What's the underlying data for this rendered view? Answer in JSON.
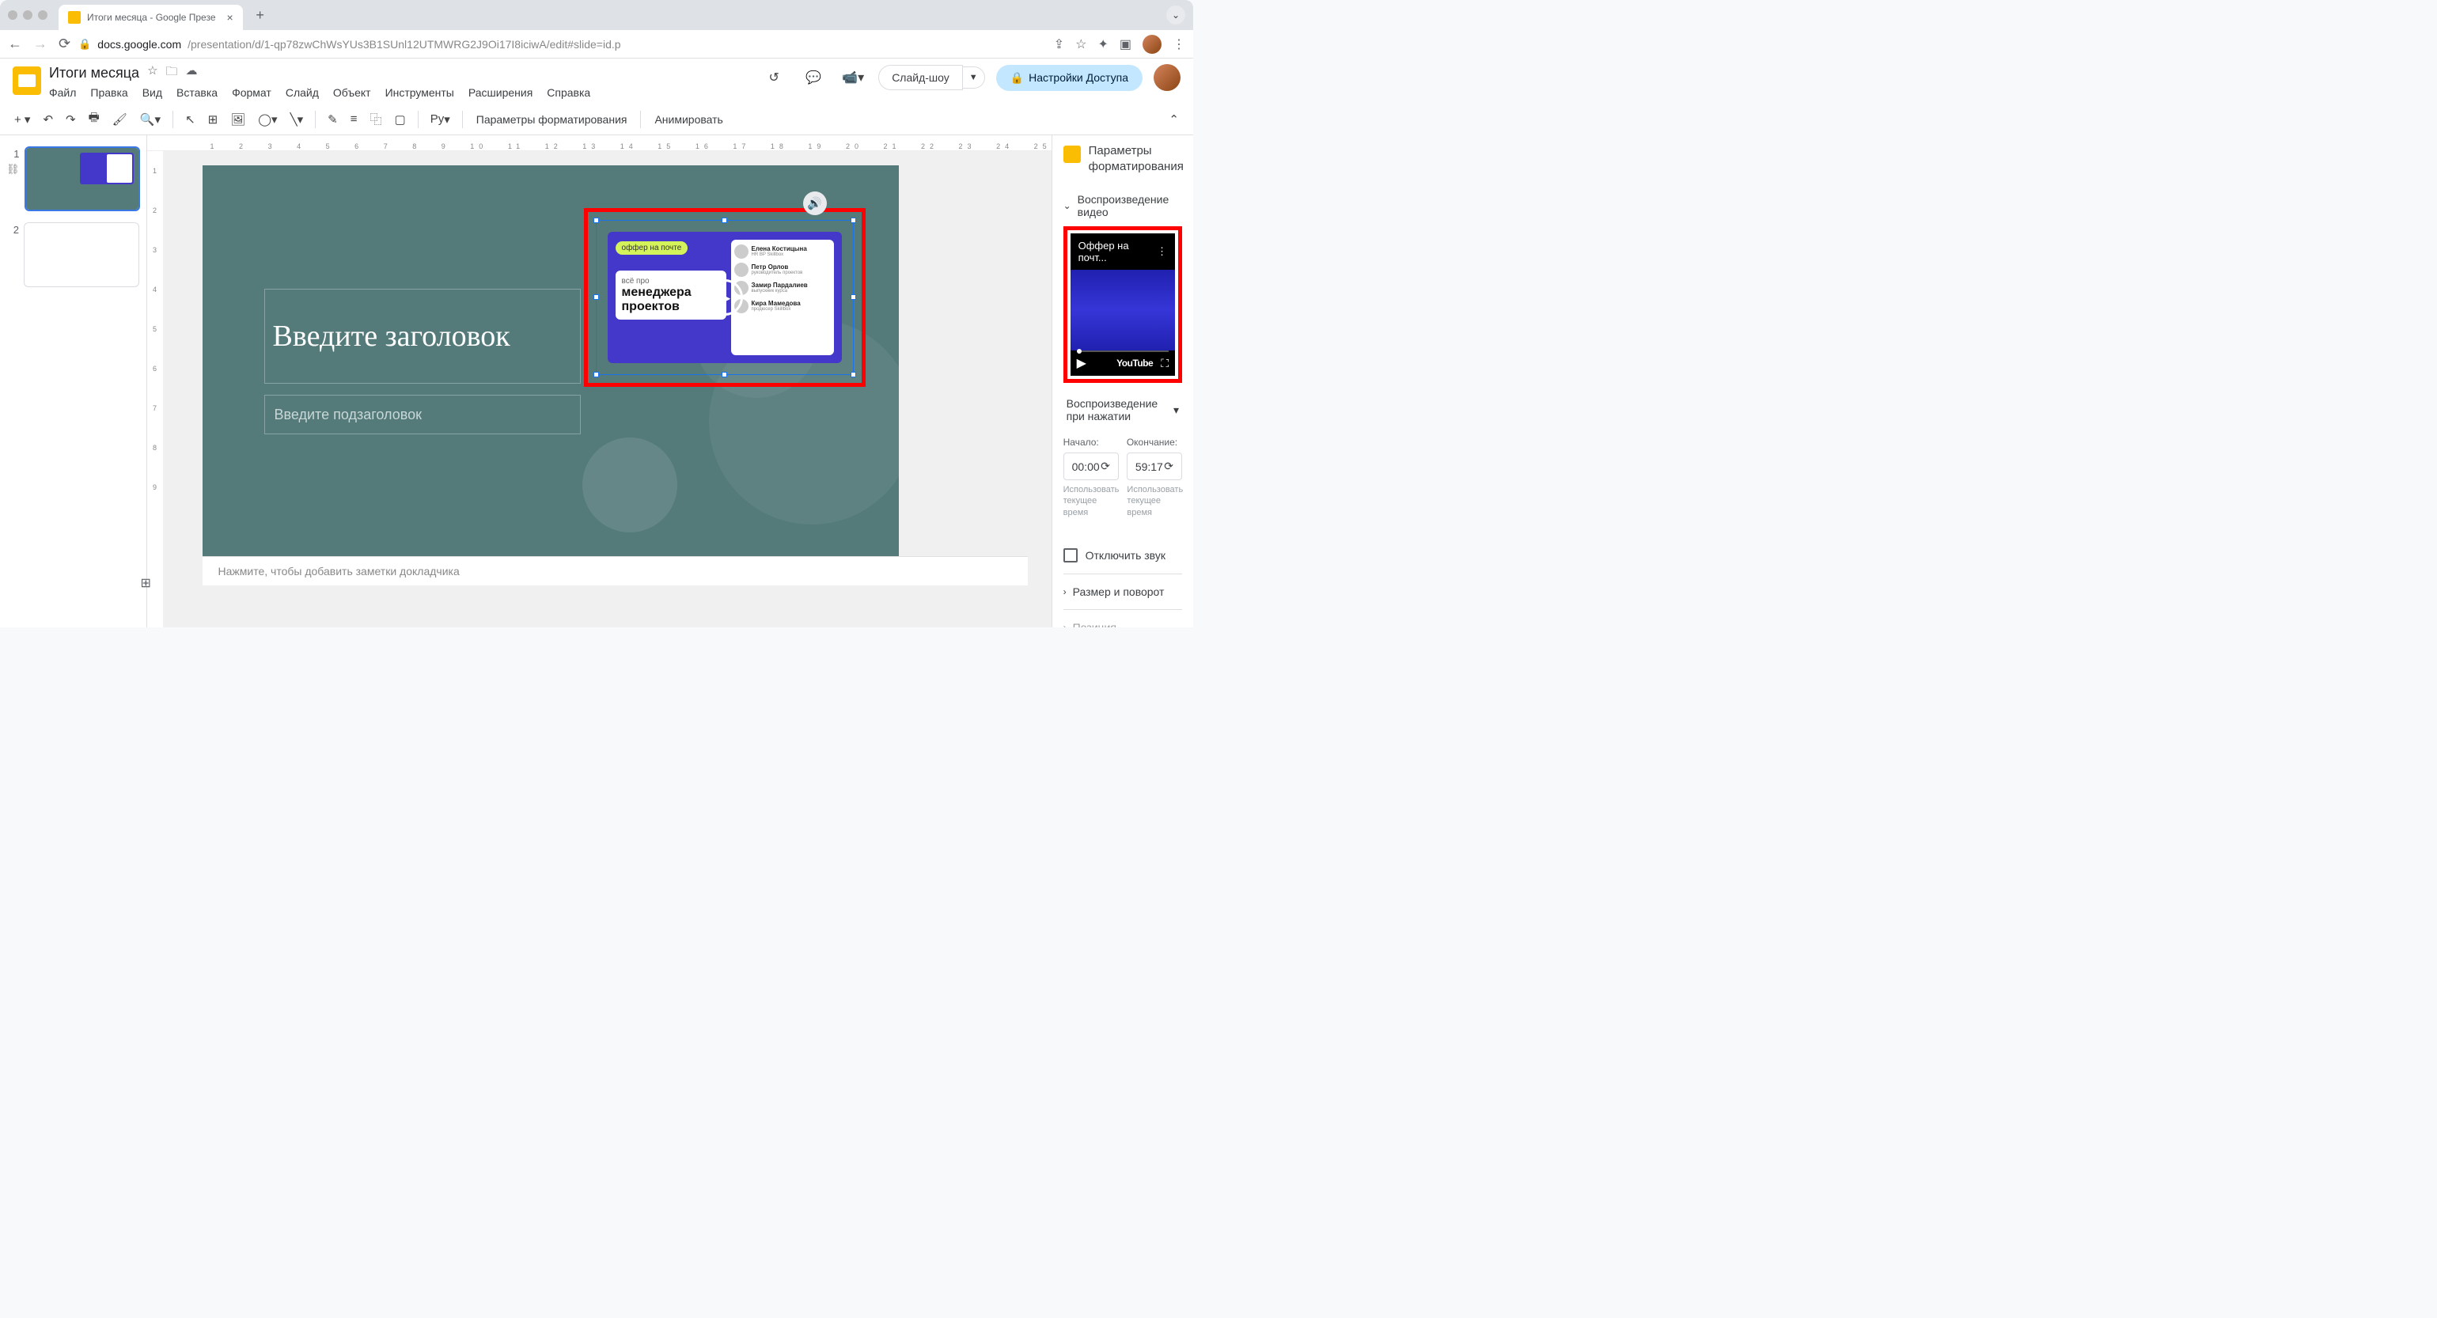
{
  "browser": {
    "tab_title": "Итоги месяца - Google Презе",
    "url_host": "docs.google.com",
    "url_path": "/presentation/d/1-qp78zwChWsYUs3B1SUnl12UTMWRG2J9Oi17I8iciwA/edit#slide=id.p"
  },
  "doc": {
    "title": "Итоги месяца"
  },
  "menubar": [
    "Файл",
    "Правка",
    "Вид",
    "Вставка",
    "Формат",
    "Слайд",
    "Объект",
    "Инструменты",
    "Расширения",
    "Справка"
  ],
  "header_actions": {
    "slideshow": "Слайд-шоу",
    "share": "Настройки Доступа"
  },
  "toolbar": {
    "format_options": "Параметры форматирования",
    "animate": "Анимировать",
    "py_label": "Py"
  },
  "ruler_h": [
    "1",
    "2",
    "3",
    "4",
    "5",
    "6",
    "7",
    "8",
    "9",
    "10",
    "11",
    "12",
    "13",
    "14",
    "15",
    "16",
    "17",
    "18",
    "19",
    "20",
    "21",
    "22",
    "23",
    "24",
    "25"
  ],
  "ruler_v": [
    "1",
    "2",
    "3",
    "4",
    "5",
    "6",
    "7",
    "8",
    "9"
  ],
  "slides": {
    "num1": "1",
    "num2": "2"
  },
  "canvas": {
    "title_placeholder": "Введите заголовок",
    "subtitle_placeholder": "Введите подзаголовок"
  },
  "video_embed": {
    "chip": "оффер на почте",
    "small_line": "всё про",
    "big_line1": "менеджера",
    "big_line2": "проектов",
    "people": [
      {
        "name": "Елена Костицына",
        "role": "HR BP Skillbox"
      },
      {
        "name": "Петр Орлов",
        "role": "руководитель проектов"
      },
      {
        "name": "Замир Пардалиев",
        "role": "выпускник курса"
      },
      {
        "name": "Кира Мамедова",
        "role": "продюсер Skillbox"
      }
    ]
  },
  "notes": {
    "placeholder": "Нажмите, чтобы добавить заметки докладчика"
  },
  "sidebar": {
    "title": "Параметры форматирования",
    "section_playback": "Воспроизведение видео",
    "preview_title": "Оффер на почт...",
    "youtube": "YouTube",
    "play_mode": "Воспроизведение при нажатии",
    "start_label": "Начало:",
    "end_label": "Окончание:",
    "start_value": "00:00",
    "end_value": "59:17",
    "hint_start": "Использовать текущее время",
    "hint_end": "Использовать текущее время",
    "mute_label": "Отключить звук",
    "section_size": "Размер и поворот",
    "section_position": "Позиция"
  }
}
